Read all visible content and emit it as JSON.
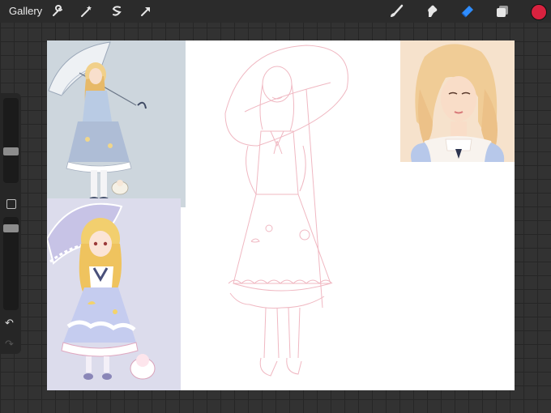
{
  "topbar": {
    "gallery_label": "Gallery",
    "left_tools": [
      {
        "name": "wrench-icon"
      },
      {
        "name": "magic-wand-icon"
      },
      {
        "name": "selection-icon"
      },
      {
        "name": "transform-arrow-icon"
      }
    ],
    "right_tools": [
      {
        "name": "brush-icon",
        "active": false
      },
      {
        "name": "smudge-icon",
        "active": false
      },
      {
        "name": "eraser-icon",
        "active": true
      },
      {
        "name": "layers-icon",
        "active": false
      }
    ],
    "current_color": "#d9223f"
  },
  "sidebar": {
    "size_slider_level": 0.25,
    "opacity_slider_level": 0.0,
    "controls": [
      "modify-button",
      "undo-icon",
      "redo-icon"
    ]
  },
  "canvas": {
    "contents": [
      "reference-image-full-body-umbrella",
      "reference-image-chibi-with-sheep",
      "reference-image-portrait",
      "pencil-sketch-lolita-girl"
    ]
  },
  "colors": {
    "accent_blue": "#2f8dff",
    "sketch_line": "#f0b8c2"
  }
}
